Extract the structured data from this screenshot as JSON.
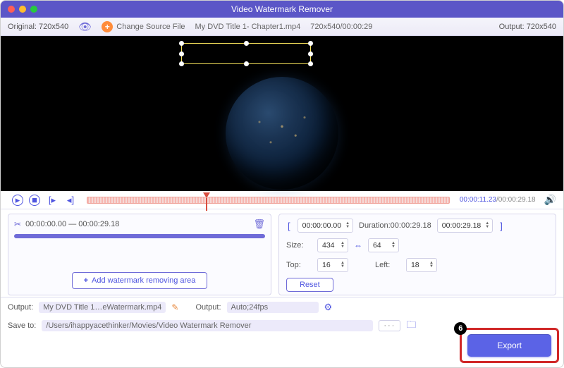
{
  "title": "Video Watermark Remover",
  "toolbar": {
    "original_label": "Original: 720x540",
    "change_source_label": "Change Source File",
    "filename": "My DVD Title 1- Chapter1.mp4",
    "file_dims": "720x540/00:00:29",
    "output_label": "Output: 720x540"
  },
  "transport": {
    "current_time": "00:00:11.23",
    "total_time": "00:00:29.18"
  },
  "clip": {
    "range": "00:00:00.00 — 00:00:29.18",
    "add_label": "Add watermark removing area"
  },
  "range": {
    "start": "00:00:00.00",
    "duration_label": "Duration:00:00:29.18",
    "end": "00:00:29.18"
  },
  "size": {
    "label": "Size:",
    "width": "434",
    "height": "64"
  },
  "pos": {
    "top_label": "Top:",
    "top": "16",
    "left_label": "Left:",
    "left": "18"
  },
  "reset_label": "Reset",
  "output": {
    "label": "Output:",
    "filename": "My DVD Title 1…eWatermark.mp4",
    "fmt_label": "Output:",
    "fmt_value": "Auto;24fps"
  },
  "save": {
    "label": "Save to:",
    "path": "/Users/ihappyacethinker/Movies/Video Watermark Remover"
  },
  "export_label": "Export",
  "annotation_step": "6"
}
